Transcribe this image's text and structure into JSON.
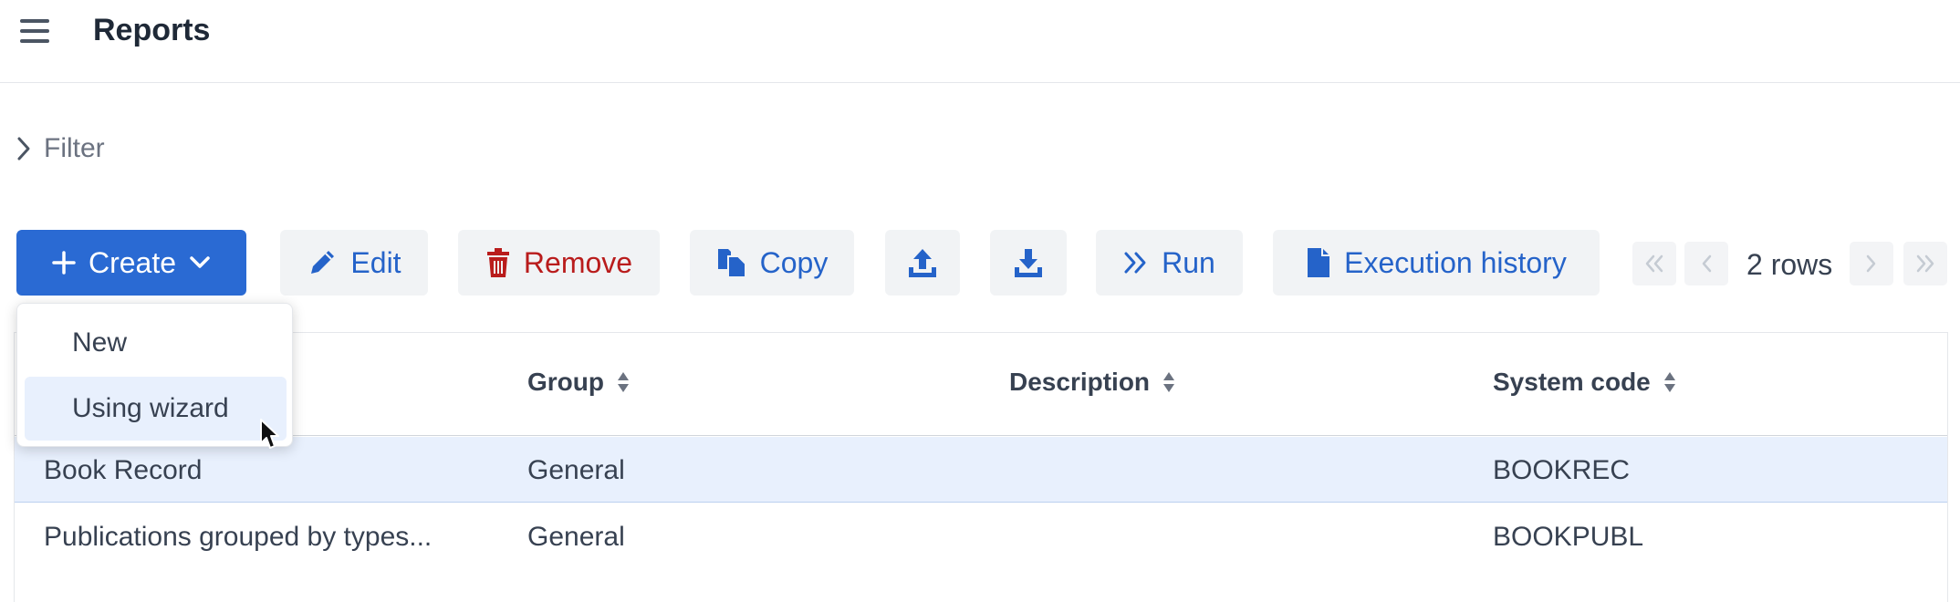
{
  "header": {
    "title": "Reports",
    "menu_icon": "hamburger-menu-icon"
  },
  "filter": {
    "label": "Filter",
    "icon": "chevron-right-icon"
  },
  "toolbar": {
    "create_label": "Create",
    "edit_label": "Edit",
    "remove_label": "Remove",
    "copy_label": "Copy",
    "run_label": "Run",
    "history_label": "Execution history",
    "export_icon": "upload-icon",
    "import_icon": "download-icon"
  },
  "pager": {
    "rows_label": "2 rows"
  },
  "create_menu": {
    "items": [
      "New",
      "Using wizard"
    ],
    "highlighted": "Using wizard"
  },
  "table": {
    "columns": [
      "Group",
      "Description",
      "System code"
    ],
    "rows": [
      {
        "name": "Book Record",
        "group": "General",
        "description": "",
        "code": "BOOKREC",
        "selected": true
      },
      {
        "name": "Publications grouped by types...",
        "group": "General",
        "description": "",
        "code": "BOOKPUBL",
        "selected": false
      }
    ]
  },
  "colors": {
    "primary": "#2a6ad3",
    "danger": "#b91c1c",
    "link": "#2563c9",
    "selected_row": "#e8f0fd",
    "button_bg": "#f1f3f5"
  }
}
